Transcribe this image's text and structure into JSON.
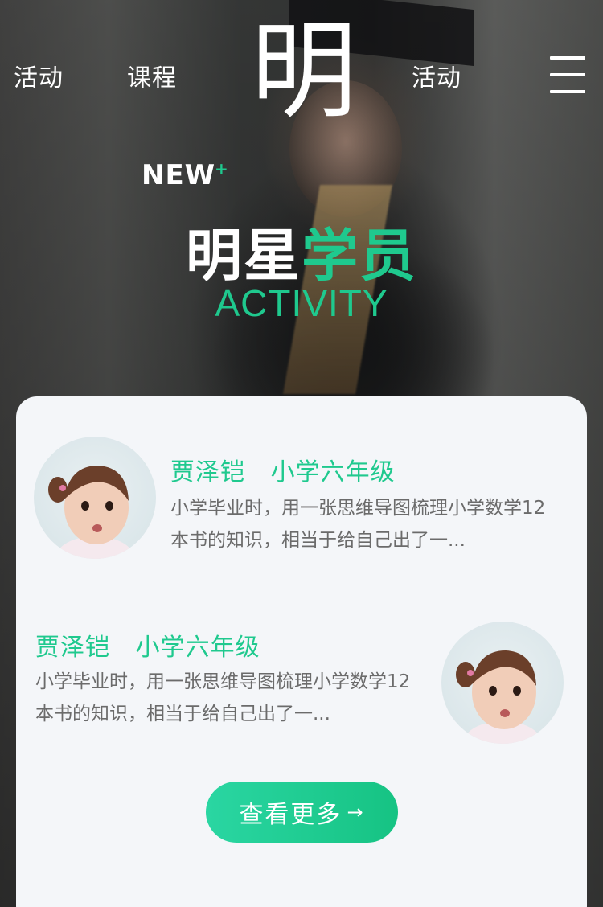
{
  "nav": {
    "left_items": [
      "活动",
      "课程"
    ],
    "logo": "明",
    "right_item": "活动",
    "menu_icon": "hamburger-menu-icon"
  },
  "section": {
    "new_label": "NEW",
    "new_plus": "+",
    "title_white": "明星",
    "title_green": "学员",
    "subtitle": "ACTIVITY"
  },
  "students": [
    {
      "name": "贾泽铠",
      "grade": "小学六年级",
      "desc_line1": "小学毕业时，用一张思维导图梳理小学数学12",
      "desc_line2": "本书的知识，相当于给自己出了一..."
    },
    {
      "name": "贾泽铠",
      "grade": "小学六年级",
      "desc_line1": "小学毕业时，用一张思维导图梳理小学数学12",
      "desc_line2": "本书的知识，相当于给自己出了一..."
    }
  ],
  "more_button": {
    "label": "查看更多",
    "icon": "arrow-right-icon"
  },
  "colors": {
    "accent": "#1fc98e",
    "card": "#f4f6f9",
    "text_gray": "#6b6b6b"
  }
}
